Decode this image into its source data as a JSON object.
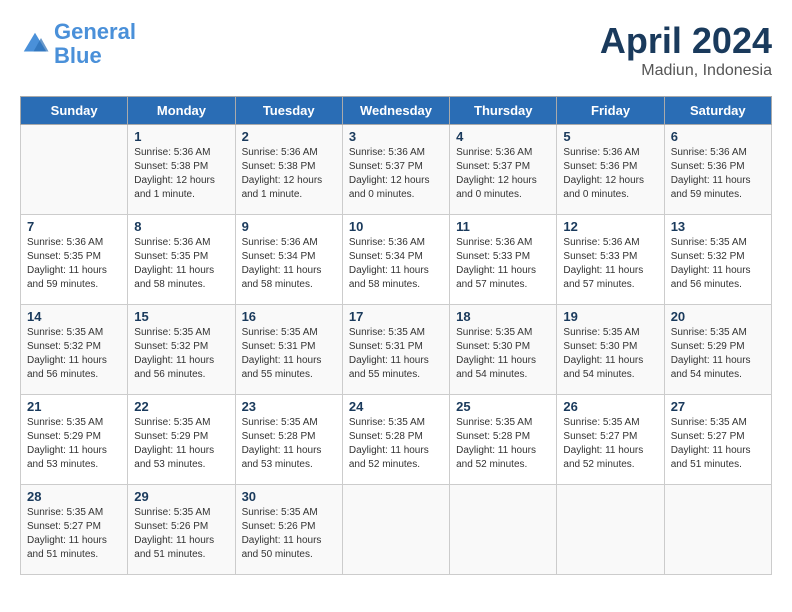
{
  "app": {
    "name": "GeneralBlue",
    "name_part1": "General",
    "name_part2": "Blue"
  },
  "title": "April 2024",
  "location": "Madiun, Indonesia",
  "days_of_week": [
    "Sunday",
    "Monday",
    "Tuesday",
    "Wednesday",
    "Thursday",
    "Friday",
    "Saturday"
  ],
  "weeks": [
    [
      {
        "day": "",
        "info": ""
      },
      {
        "day": "1",
        "info": "Sunrise: 5:36 AM\nSunset: 5:38 PM\nDaylight: 12 hours\nand 1 minute."
      },
      {
        "day": "2",
        "info": "Sunrise: 5:36 AM\nSunset: 5:38 PM\nDaylight: 12 hours\nand 1 minute."
      },
      {
        "day": "3",
        "info": "Sunrise: 5:36 AM\nSunset: 5:37 PM\nDaylight: 12 hours\nand 0 minutes."
      },
      {
        "day": "4",
        "info": "Sunrise: 5:36 AM\nSunset: 5:37 PM\nDaylight: 12 hours\nand 0 minutes."
      },
      {
        "day": "5",
        "info": "Sunrise: 5:36 AM\nSunset: 5:36 PM\nDaylight: 12 hours\nand 0 minutes."
      },
      {
        "day": "6",
        "info": "Sunrise: 5:36 AM\nSunset: 5:36 PM\nDaylight: 11 hours\nand 59 minutes."
      }
    ],
    [
      {
        "day": "7",
        "info": "Sunrise: 5:36 AM\nSunset: 5:35 PM\nDaylight: 11 hours\nand 59 minutes."
      },
      {
        "day": "8",
        "info": "Sunrise: 5:36 AM\nSunset: 5:35 PM\nDaylight: 11 hours\nand 58 minutes."
      },
      {
        "day": "9",
        "info": "Sunrise: 5:36 AM\nSunset: 5:34 PM\nDaylight: 11 hours\nand 58 minutes."
      },
      {
        "day": "10",
        "info": "Sunrise: 5:36 AM\nSunset: 5:34 PM\nDaylight: 11 hours\nand 58 minutes."
      },
      {
        "day": "11",
        "info": "Sunrise: 5:36 AM\nSunset: 5:33 PM\nDaylight: 11 hours\nand 57 minutes."
      },
      {
        "day": "12",
        "info": "Sunrise: 5:36 AM\nSunset: 5:33 PM\nDaylight: 11 hours\nand 57 minutes."
      },
      {
        "day": "13",
        "info": "Sunrise: 5:35 AM\nSunset: 5:32 PM\nDaylight: 11 hours\nand 56 minutes."
      }
    ],
    [
      {
        "day": "14",
        "info": "Sunrise: 5:35 AM\nSunset: 5:32 PM\nDaylight: 11 hours\nand 56 minutes."
      },
      {
        "day": "15",
        "info": "Sunrise: 5:35 AM\nSunset: 5:32 PM\nDaylight: 11 hours\nand 56 minutes."
      },
      {
        "day": "16",
        "info": "Sunrise: 5:35 AM\nSunset: 5:31 PM\nDaylight: 11 hours\nand 55 minutes."
      },
      {
        "day": "17",
        "info": "Sunrise: 5:35 AM\nSunset: 5:31 PM\nDaylight: 11 hours\nand 55 minutes."
      },
      {
        "day": "18",
        "info": "Sunrise: 5:35 AM\nSunset: 5:30 PM\nDaylight: 11 hours\nand 54 minutes."
      },
      {
        "day": "19",
        "info": "Sunrise: 5:35 AM\nSunset: 5:30 PM\nDaylight: 11 hours\nand 54 minutes."
      },
      {
        "day": "20",
        "info": "Sunrise: 5:35 AM\nSunset: 5:29 PM\nDaylight: 11 hours\nand 54 minutes."
      }
    ],
    [
      {
        "day": "21",
        "info": "Sunrise: 5:35 AM\nSunset: 5:29 PM\nDaylight: 11 hours\nand 53 minutes."
      },
      {
        "day": "22",
        "info": "Sunrise: 5:35 AM\nSunset: 5:29 PM\nDaylight: 11 hours\nand 53 minutes."
      },
      {
        "day": "23",
        "info": "Sunrise: 5:35 AM\nSunset: 5:28 PM\nDaylight: 11 hours\nand 53 minutes."
      },
      {
        "day": "24",
        "info": "Sunrise: 5:35 AM\nSunset: 5:28 PM\nDaylight: 11 hours\nand 52 minutes."
      },
      {
        "day": "25",
        "info": "Sunrise: 5:35 AM\nSunset: 5:28 PM\nDaylight: 11 hours\nand 52 minutes."
      },
      {
        "day": "26",
        "info": "Sunrise: 5:35 AM\nSunset: 5:27 PM\nDaylight: 11 hours\nand 52 minutes."
      },
      {
        "day": "27",
        "info": "Sunrise: 5:35 AM\nSunset: 5:27 PM\nDaylight: 11 hours\nand 51 minutes."
      }
    ],
    [
      {
        "day": "28",
        "info": "Sunrise: 5:35 AM\nSunset: 5:27 PM\nDaylight: 11 hours\nand 51 minutes."
      },
      {
        "day": "29",
        "info": "Sunrise: 5:35 AM\nSunset: 5:26 PM\nDaylight: 11 hours\nand 51 minutes."
      },
      {
        "day": "30",
        "info": "Sunrise: 5:35 AM\nSunset: 5:26 PM\nDaylight: 11 hours\nand 50 minutes."
      },
      {
        "day": "",
        "info": ""
      },
      {
        "day": "",
        "info": ""
      },
      {
        "day": "",
        "info": ""
      },
      {
        "day": "",
        "info": ""
      }
    ]
  ]
}
